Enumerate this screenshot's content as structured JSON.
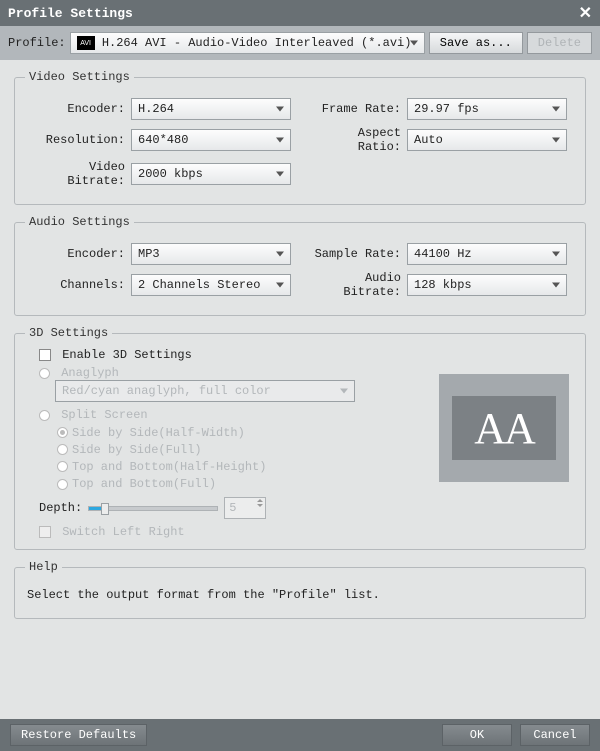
{
  "title": "Profile Settings",
  "profile": {
    "label": "Profile:",
    "icon_text": "AVI",
    "value": "H.264 AVI - Audio-Video Interleaved (*.avi)",
    "save_as": "Save as...",
    "delete": "Delete"
  },
  "video": {
    "legend": "Video Settings",
    "encoder_label": "Encoder:",
    "encoder_value": "H.264",
    "resolution_label": "Resolution:",
    "resolution_value": "640*480",
    "bitrate_label": "Video Bitrate:",
    "bitrate_value": "2000 kbps",
    "framerate_label": "Frame Rate:",
    "framerate_value": "29.97 fps",
    "aspect_label": "Aspect Ratio:",
    "aspect_value": "Auto"
  },
  "audio": {
    "legend": "Audio Settings",
    "encoder_label": "Encoder:",
    "encoder_value": "MP3",
    "channels_label": "Channels:",
    "channels_value": "2 Channels Stereo",
    "samplerate_label": "Sample Rate:",
    "samplerate_value": "44100 Hz",
    "bitrate_label": "Audio Bitrate:",
    "bitrate_value": "128 kbps"
  },
  "three_d": {
    "legend": "3D Settings",
    "enable": "Enable 3D Settings",
    "anaglyph": "Anaglyph",
    "anaglyph_value": "Red/cyan anaglyph, full color",
    "split": "Split Screen",
    "opt1": "Side by Side(Half-Width)",
    "opt2": "Side by Side(Full)",
    "opt3": "Top and Bottom(Half-Height)",
    "opt4": "Top and Bottom(Full)",
    "depth_label": "Depth:",
    "depth_value": "5",
    "switch": "Switch Left Right",
    "preview_text": "AA"
  },
  "help": {
    "legend": "Help",
    "text": "Select the output format from the \"Profile\" list."
  },
  "footer": {
    "restore": "Restore Defaults",
    "ok": "OK",
    "cancel": "Cancel"
  }
}
